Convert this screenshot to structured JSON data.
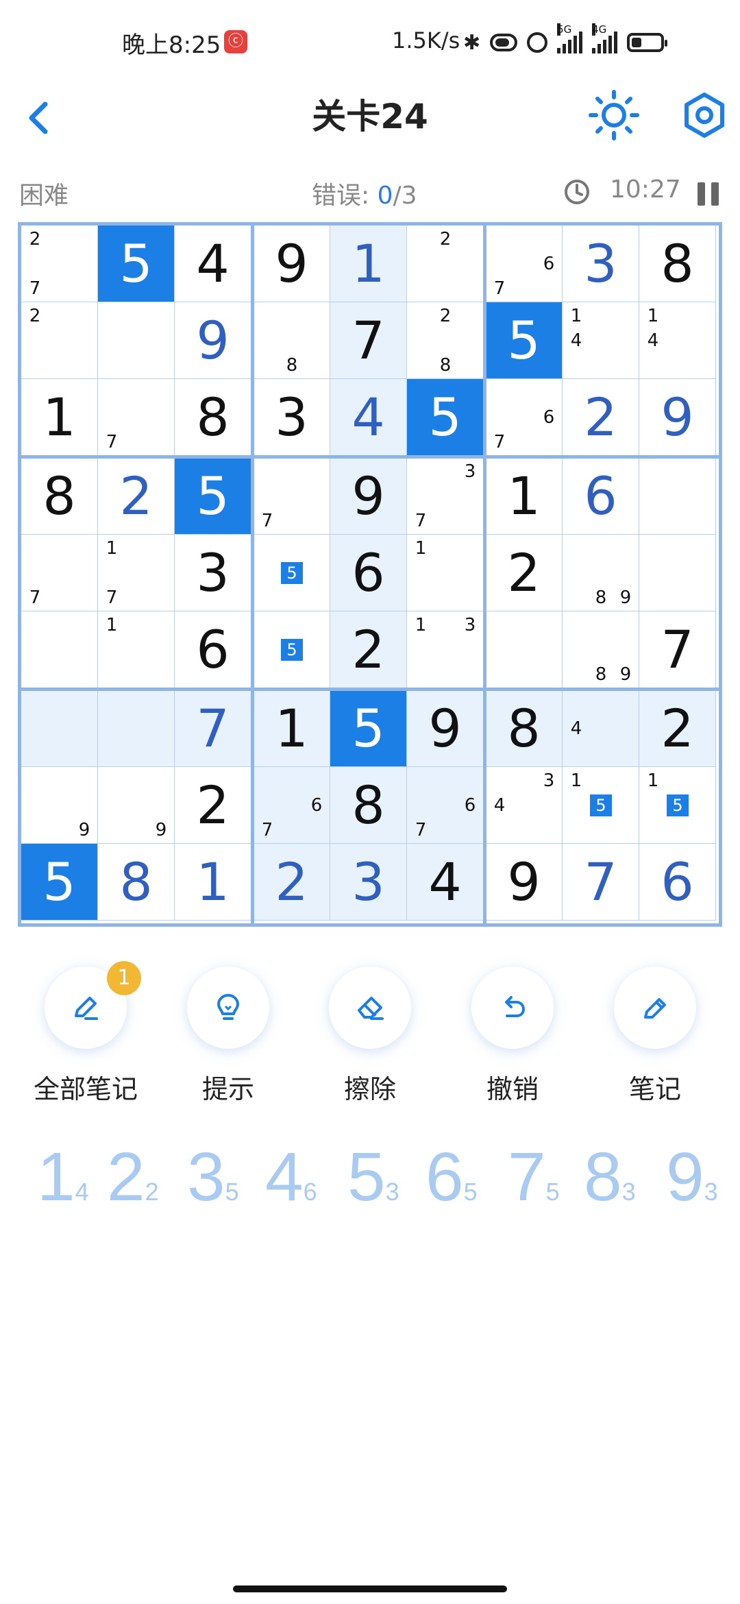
{
  "status": {
    "time": "晚上8:25",
    "app_badge": "ⓒ",
    "speed": "1.5K/s",
    "sig5g_label": "5G",
    "sig4g_label": "4G"
  },
  "header": {
    "title": "关卡24"
  },
  "info": {
    "difficulty": "困难",
    "errors_label": "错误: ",
    "errors_current": "0",
    "errors_sep": "/",
    "errors_max": "3",
    "timer": "10:27"
  },
  "board": {
    "rows": [
      [
        {
          "v": "",
          "n": [
            "2",
            "",
            "",
            "",
            "",
            "",
            "7",
            "",
            ""
          ]
        },
        {
          "v": "5",
          "t": "given",
          "sel": true
        },
        {
          "v": "4",
          "t": "given"
        },
        {
          "v": "9",
          "t": "given"
        },
        {
          "v": "1",
          "t": "user",
          "hl": true
        },
        {
          "v": "",
          "n": [
            "",
            "2",
            "",
            "",
            "",
            "",
            "",
            "",
            ""
          ]
        },
        {
          "v": "",
          "n": [
            "",
            "",
            "",
            "",
            "",
            "6",
            "7",
            "",
            ""
          ]
        },
        {
          "v": "3",
          "t": "user"
        },
        {
          "v": "8",
          "t": "given"
        }
      ],
      [
        {
          "v": "",
          "n": [
            "2",
            "",
            "",
            "",
            "",
            "",
            "",
            "",
            ""
          ]
        },
        {
          "v": ""
        },
        {
          "v": "9",
          "t": "user"
        },
        {
          "v": "",
          "n": [
            "",
            "",
            "",
            "",
            "",
            "",
            "",
            "8",
            ""
          ]
        },
        {
          "v": "7",
          "t": "given",
          "hl": true
        },
        {
          "v": "",
          "n": [
            "",
            "2",
            "",
            "",
            "",
            "",
            "",
            "8",
            ""
          ]
        },
        {
          "v": "5",
          "t": "given",
          "sel": true
        },
        {
          "v": "",
          "n": [
            "1",
            "",
            "",
            "4",
            "",
            "",
            "",
            "",
            ""
          ]
        },
        {
          "v": "",
          "n": [
            "1",
            "",
            "",
            "4",
            "",
            "",
            "",
            "",
            ""
          ]
        }
      ],
      [
        {
          "v": "1",
          "t": "given"
        },
        {
          "v": "",
          "n": [
            "",
            "",
            "",
            "",
            "",
            "",
            "7",
            "",
            ""
          ]
        },
        {
          "v": "8",
          "t": "given"
        },
        {
          "v": "3",
          "t": "given"
        },
        {
          "v": "4",
          "t": "user",
          "hl": true
        },
        {
          "v": "5",
          "t": "given",
          "sel": true
        },
        {
          "v": "",
          "n": [
            "",
            "",
            "",
            "",
            "",
            "6",
            "7",
            "",
            ""
          ]
        },
        {
          "v": "2",
          "t": "user"
        },
        {
          "v": "9",
          "t": "user"
        }
      ],
      [
        {
          "v": "8",
          "t": "given"
        },
        {
          "v": "2",
          "t": "user"
        },
        {
          "v": "5",
          "t": "given",
          "sel": true
        },
        {
          "v": "",
          "n": [
            "",
            "",
            "",
            "",
            "",
            "",
            "7",
            "",
            ""
          ]
        },
        {
          "v": "9",
          "t": "given",
          "hl": true
        },
        {
          "v": "",
          "n": [
            "",
            "",
            "3",
            "",
            "",
            "",
            "7",
            "",
            ""
          ]
        },
        {
          "v": "1",
          "t": "given"
        },
        {
          "v": "6",
          "t": "user"
        },
        {
          "v": ""
        }
      ],
      [
        {
          "v": "",
          "n": [
            "",
            "",
            "",
            "",
            "",
            "",
            "7",
            "",
            ""
          ]
        },
        {
          "v": "",
          "n": [
            "1",
            "",
            "",
            "",
            "",
            "",
            "7",
            "",
            ""
          ]
        },
        {
          "v": "3",
          "t": "given"
        },
        {
          "v": "",
          "box": "5"
        },
        {
          "v": "6",
          "t": "given",
          "hl": true
        },
        {
          "v": "",
          "n": [
            "1",
            "",
            "",
            "",
            "",
            "",
            "",
            "",
            ""
          ]
        },
        {
          "v": "2",
          "t": "given"
        },
        {
          "v": "",
          "n": [
            "",
            "",
            "",
            "",
            "",
            "",
            "",
            "8",
            "9"
          ]
        },
        {
          "v": ""
        }
      ],
      [
        {
          "v": ""
        },
        {
          "v": "",
          "n": [
            "1",
            "",
            "",
            "",
            "",
            "",
            "",
            "",
            ""
          ]
        },
        {
          "v": "6",
          "t": "given"
        },
        {
          "v": "",
          "box": "5"
        },
        {
          "v": "2",
          "t": "given",
          "hl": true
        },
        {
          "v": "",
          "n": [
            "1",
            "",
            "3",
            "",
            "",
            "",
            "",
            "",
            ""
          ]
        },
        {
          "v": ""
        },
        {
          "v": "",
          "n": [
            "",
            "",
            "",
            "",
            "",
            "",
            "",
            "8",
            "9"
          ]
        },
        {
          "v": "7",
          "t": "given"
        }
      ],
      [
        {
          "v": "",
          "hl": true
        },
        {
          "v": "",
          "hl": true
        },
        {
          "v": "7",
          "t": "user",
          "hl": true
        },
        {
          "v": "1",
          "t": "given",
          "hl": true
        },
        {
          "v": "5",
          "t": "given",
          "sel": true
        },
        {
          "v": "9",
          "t": "given",
          "hl": true
        },
        {
          "v": "8",
          "t": "given",
          "hl": true
        },
        {
          "v": "",
          "hl": true,
          "n": [
            "",
            "",
            "",
            "4",
            "",
            "",
            "",
            "",
            ""
          ]
        },
        {
          "v": "2",
          "t": "given",
          "hl": true
        }
      ],
      [
        {
          "v": "",
          "n": [
            "",
            "",
            "",
            "",
            "",
            "",
            "",
            "",
            "9"
          ]
        },
        {
          "v": "",
          "n": [
            "",
            "",
            "",
            "",
            "",
            "",
            "",
            "",
            "9"
          ]
        },
        {
          "v": "2",
          "t": "given"
        },
        {
          "v": "",
          "hl": true,
          "n": [
            "",
            "",
            "",
            "",
            "",
            "6",
            "7",
            "",
            ""
          ]
        },
        {
          "v": "8",
          "t": "given",
          "hl": true
        },
        {
          "v": "",
          "hl": true,
          "n": [
            "",
            "",
            "",
            "",
            "",
            "6",
            "7",
            "",
            ""
          ]
        },
        {
          "v": "",
          "n": [
            "",
            "",
            "3",
            "4",
            "",
            "",
            "",
            "",
            ""
          ]
        },
        {
          "v": "",
          "n": [
            "1",
            "",
            "",
            "",
            "",
            "",
            "",
            "",
            ""
          ],
          "box": "5"
        },
        {
          "v": "",
          "n": [
            "1",
            "",
            "",
            "",
            "",
            "",
            "",
            "",
            ""
          ],
          "box": "5"
        }
      ],
      [
        {
          "v": "5",
          "t": "given",
          "sel": true
        },
        {
          "v": "8",
          "t": "user"
        },
        {
          "v": "1",
          "t": "user"
        },
        {
          "v": "2",
          "t": "user",
          "hl": true
        },
        {
          "v": "3",
          "t": "user",
          "hl": true
        },
        {
          "v": "4",
          "t": "given",
          "hl": true
        },
        {
          "v": "9",
          "t": "given"
        },
        {
          "v": "7",
          "t": "user"
        },
        {
          "v": "6",
          "t": "user"
        }
      ]
    ]
  },
  "tools": {
    "all_notes": {
      "label": "全部笔记",
      "badge": "1",
      "icon": "pencil-icon"
    },
    "hint": {
      "label": "提示",
      "icon": "lightbulb-icon"
    },
    "erase": {
      "label": "擦除",
      "icon": "eraser-icon"
    },
    "undo": {
      "label": "撤销",
      "icon": "undo-icon"
    },
    "notes": {
      "label": "笔记",
      "icon": "pencil-icon"
    }
  },
  "numpad": [
    {
      "digit": "1",
      "remaining": "4"
    },
    {
      "digit": "2",
      "remaining": "2"
    },
    {
      "digit": "3",
      "remaining": "5"
    },
    {
      "digit": "4",
      "remaining": "6"
    },
    {
      "digit": "5",
      "remaining": "3"
    },
    {
      "digit": "6",
      "remaining": "5"
    },
    {
      "digit": "7",
      "remaining": "5"
    },
    {
      "digit": "8",
      "remaining": "3"
    },
    {
      "digit": "9",
      "remaining": "3"
    }
  ],
  "colors": {
    "accent": "#1b7fe6",
    "highlight": "#e8f2fd",
    "grid": "#8db6e6",
    "numpad": "#a9cbf1",
    "badge": "#f2b733"
  }
}
